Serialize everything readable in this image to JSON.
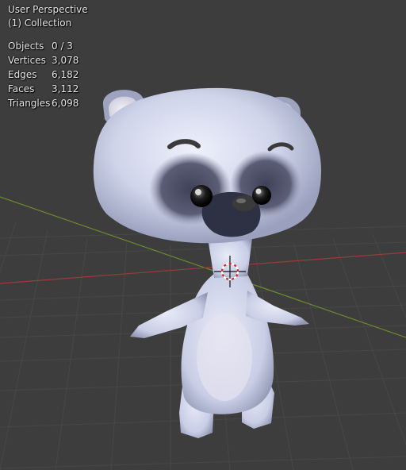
{
  "viewport": {
    "view_name": "User Perspective",
    "collection": "(1) Collection"
  },
  "stats": [
    {
      "label": "Objects",
      "value": "0 / 3"
    },
    {
      "label": "Vertices",
      "value": "3,078"
    },
    {
      "label": "Edges",
      "value": "6,182"
    },
    {
      "label": "Faces",
      "value": "3,112"
    },
    {
      "label": "Triangles",
      "value": "6,098"
    }
  ],
  "colors": {
    "background": "#3d3d3d",
    "grid": "#4a4a4a",
    "x_axis": "#9b3b3b",
    "y_axis": "#6b8a2e",
    "model_body": "#cdd3ea",
    "model_dark": "#4a4d63"
  }
}
